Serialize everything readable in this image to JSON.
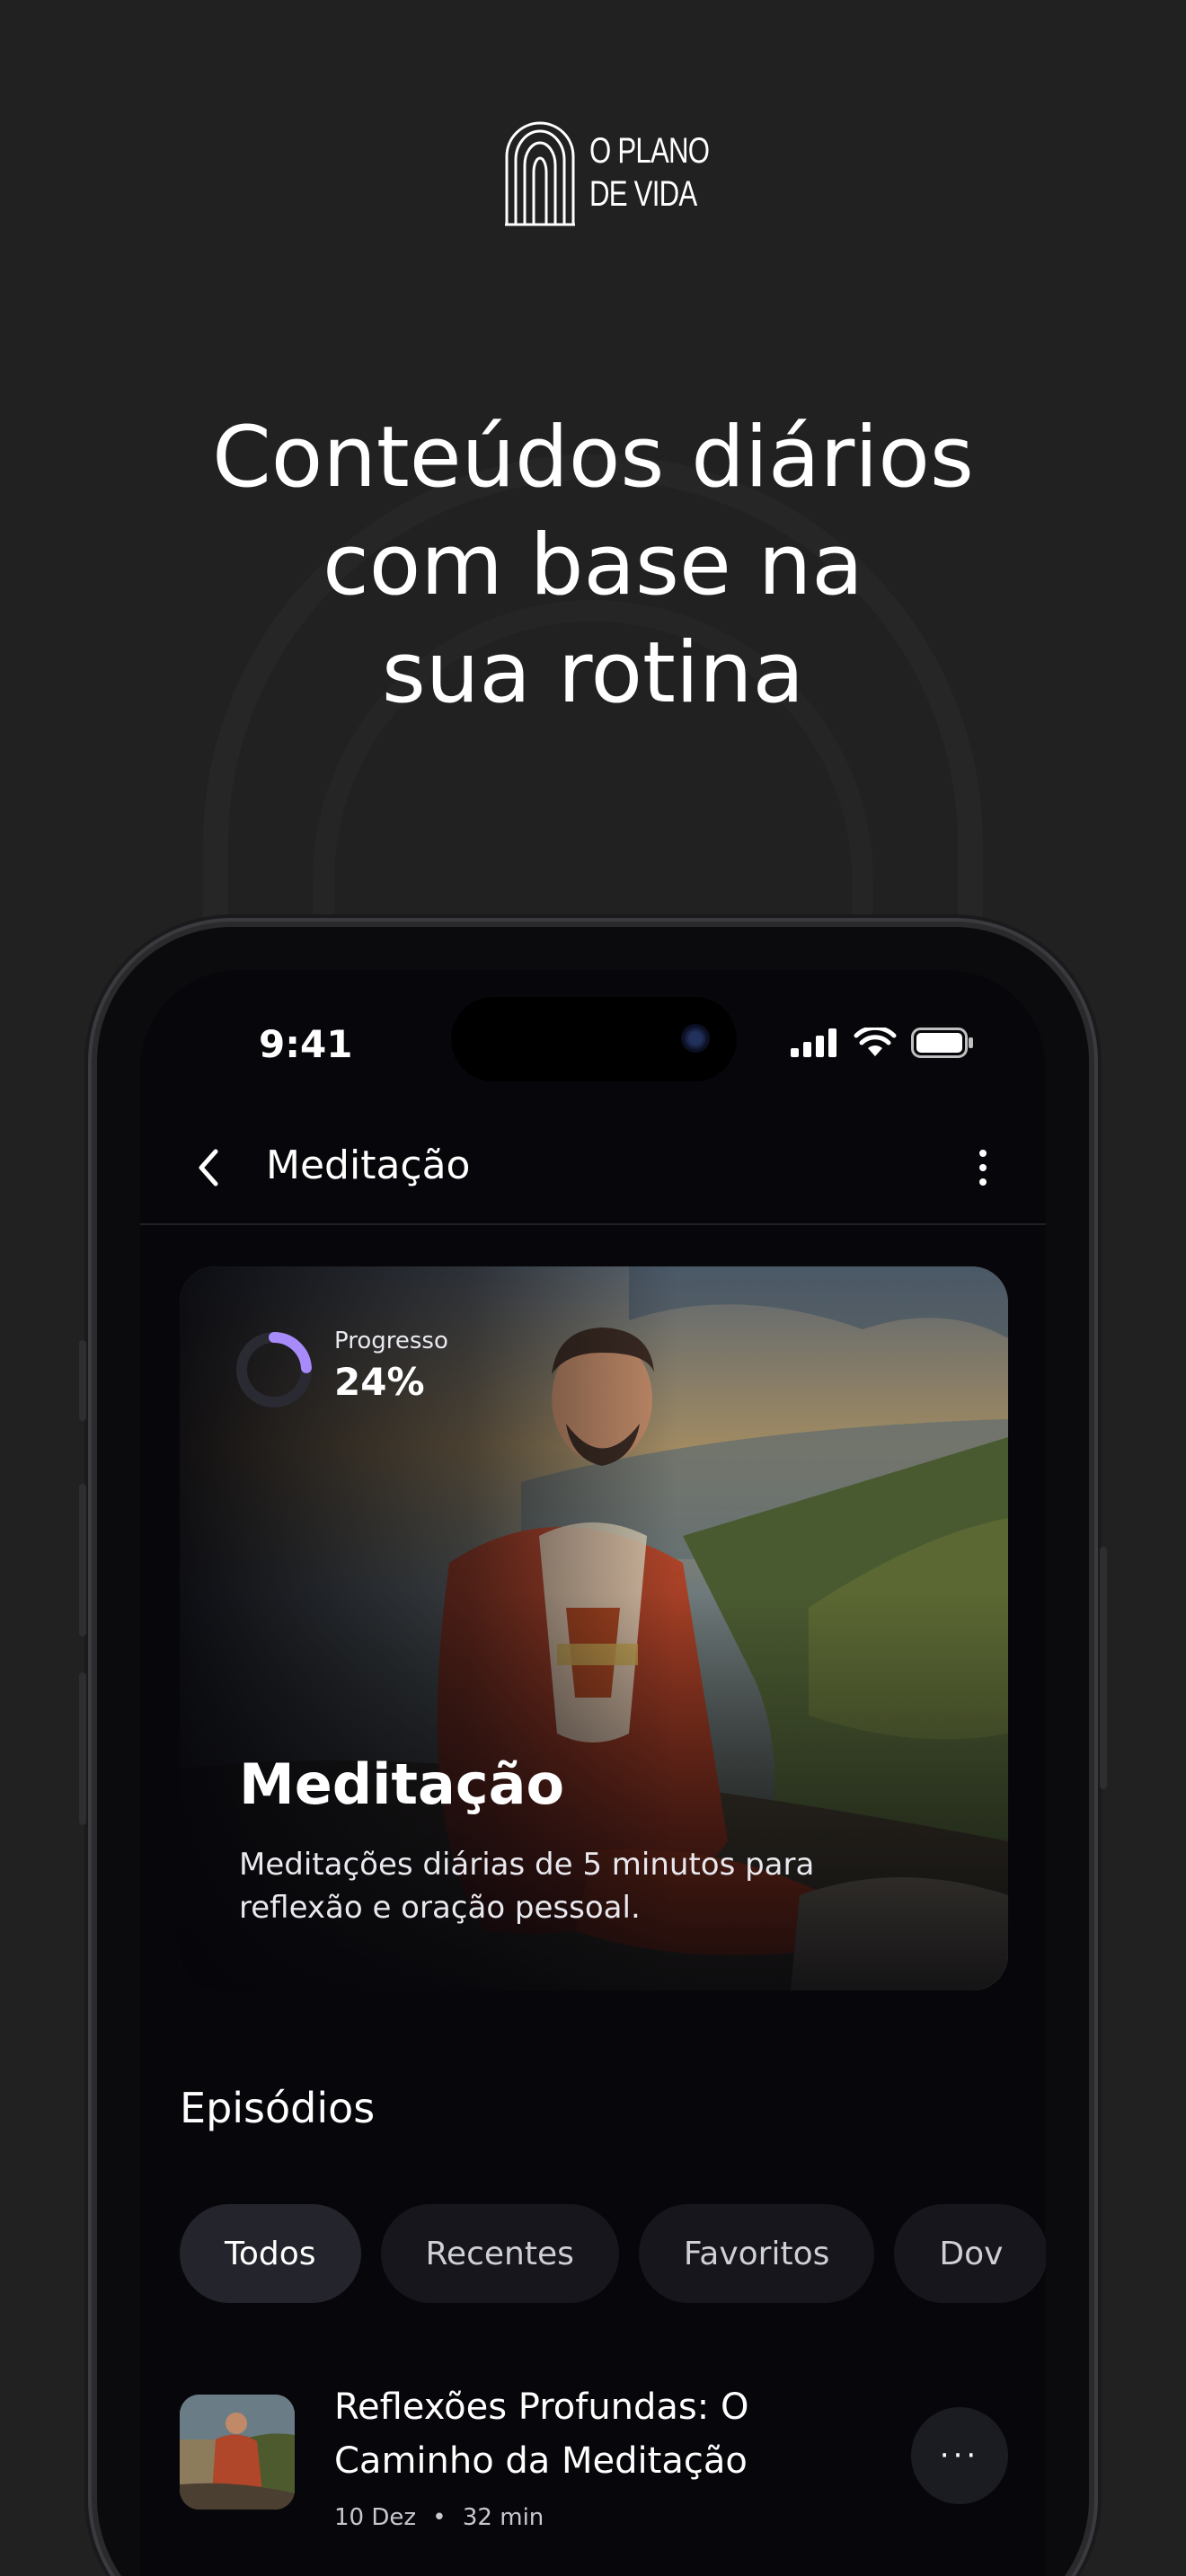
{
  "brand": {
    "line1": "O PLANO",
    "line2": "DE VIDA",
    "logo_icon": "arch-logo-icon"
  },
  "headline": {
    "line1": "Conteúdos diários",
    "line2": "com base na",
    "line3": "sua rotina"
  },
  "status_bar": {
    "time": "9:41",
    "icons": [
      "signal-icon",
      "wifi-icon",
      "battery-icon"
    ]
  },
  "app_bar": {
    "title": "Meditação",
    "back_icon": "chevron-left-icon",
    "menu_icon": "kebab-menu-icon"
  },
  "hero": {
    "progress_label": "Progresso",
    "progress_value": "24%",
    "progress_fraction": 0.24,
    "title": "Meditação",
    "description": "Meditações diárias de 5 minutos para reflexão e oração pessoal."
  },
  "episodes": {
    "section_title": "Episódios",
    "filters": [
      {
        "label": "Todos",
        "active": true
      },
      {
        "label": "Recentes",
        "active": false
      },
      {
        "label": "Favoritos",
        "active": false
      },
      {
        "label": "Dov",
        "active": false
      }
    ],
    "items": [
      {
        "title": "Reflexões Profundas: O Caminho da Meditação",
        "date": "10 Dez",
        "duration": "32 min",
        "separator": "•",
        "more_label": "···"
      }
    ]
  },
  "colors": {
    "page_bg": "#212121",
    "screen_bg": "#07070b",
    "accent_progress": "#a78bfa",
    "chip_bg": "#16161c"
  }
}
